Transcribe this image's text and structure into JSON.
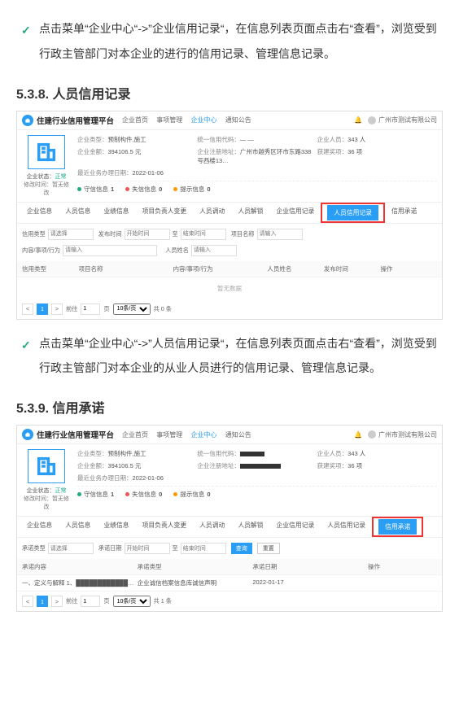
{
  "para1": "点击菜单“企业中心“->”企业信用记录“，在信息列表页面点击右“查看”，浏览受到行政主管部门对本企业的进行的信用记录、管理信息记录。",
  "section1_title": "5.3.8. 人员信用记录",
  "para2": "点击菜单“企业中心“->”人员信用记录“，在信息列表页面点击右“查看”，浏览受到行政主管部门对本企业的从业人员进行的信用记录、管理信息记录。",
  "section2_title": "5.3.9. 信用承诺",
  "common": {
    "platform_name": "住建行业信用管理平台",
    "topnav": [
      "企业首页",
      "事项管理",
      "企业中心",
      "通知公告"
    ],
    "user_company": "广州市测试有限公司",
    "status_label": "企业状态：",
    "status_value": "正常",
    "mod_label": "修改时间：暂无修改",
    "info_type_label": "企业类型：",
    "info_type_value": "预制构件,施工",
    "info_code_label": "统一信用代码：",
    "info_code_value": "— —",
    "info_staff_label": "企业人员：",
    "info_staff_value": "343 人",
    "info_amount_label": "企业金额：",
    "info_amount_value": "394106.5 元",
    "info_addr_label": "企业注册地址：",
    "info_addr_value": "广州市越秀区环市东路338号西楼13…",
    "info_award_label": "获建奖项：",
    "info_award_value": "36 项",
    "info_date_label": "最近业务办理日期：",
    "info_date_value": "2022-01-06",
    "stat_sx": "守信信息",
    "stat_sx_n": "1",
    "stat_sxi": "失信信息",
    "stat_sxi_n": "0",
    "stat_ts": "提示信息",
    "stat_ts_n": "0",
    "tabs": [
      "企业信息",
      "人员信息",
      "业绩信息",
      "项目负责人变更",
      "人员调动",
      "人员解锁",
      "企业信用记录",
      "人员信用记录",
      "信用承诺"
    ]
  },
  "ss1": {
    "filters": {
      "credit_type": "信用类型",
      "pub_date": "发布时间",
      "to": "至",
      "proj_name": "项目名称",
      "content": "内容/事项/行为",
      "name": "人员姓名",
      "ph_select": "请选择",
      "ph_start": "开始时间",
      "ph_end": "结束时间",
      "ph_input": "请输入"
    },
    "table": {
      "cols": [
        "信用类型",
        "项目名称",
        "内容/事项/行为",
        "人员姓名",
        "发布时间",
        "操作"
      ],
      "nodata": "暂无数据"
    },
    "pager": {
      "prev": "<",
      "page": "1",
      "next": ">",
      "goto_pre": "前往",
      "goto_suf": "页",
      "size": "10条/页",
      "total": "共 0 条"
    }
  },
  "ss2": {
    "filters": {
      "type": "承诺类型",
      "date": "承诺日期",
      "to": "至",
      "ph_select": "请选择",
      "ph_start": "开始时间",
      "ph_end": "结束时间",
      "btn_search": "查询",
      "btn_reset": "重置"
    },
    "table": {
      "cols": [
        "承诺内容",
        "承诺类型",
        "承诺日期",
        "操作"
      ],
      "row_content": "一、定义与解释 1、█████████████…",
      "row_type": "企业诚信档案信息库诚信声明",
      "row_date": "2022-01-17"
    },
    "pager": {
      "prev": "<",
      "page": "1",
      "next": ">",
      "goto_pre": "前往",
      "goto_suf": "页",
      "size": "10条/页",
      "total": "共 1 条"
    }
  }
}
